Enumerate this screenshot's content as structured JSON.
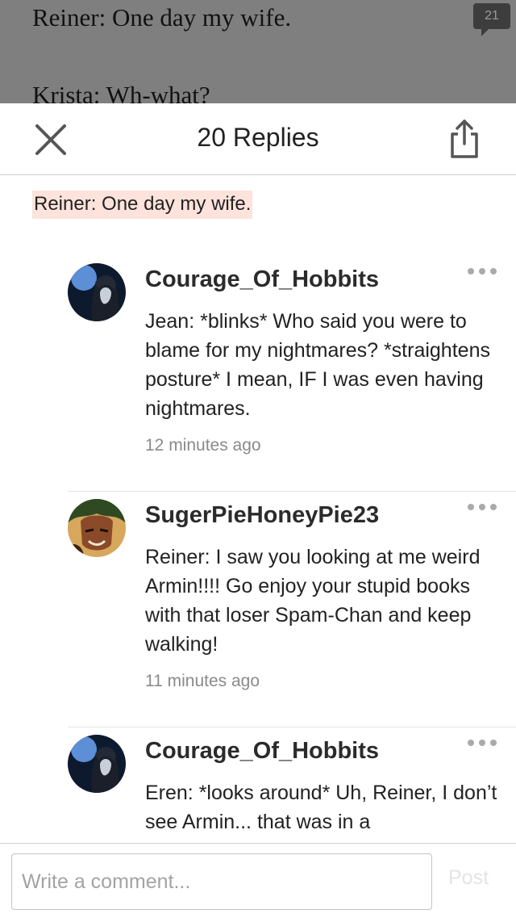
{
  "story": {
    "line1": "Reiner: One day my wife.",
    "line2": "Krista: Wh-what?",
    "comment_count": "21"
  },
  "sheet": {
    "title": "20 Replies",
    "quote": "Reiner: One day my wife."
  },
  "comments": [
    {
      "username": "Courage_Of_Hobbits",
      "body": "Jean: *blinks* Who said you were to blame for my nightmares? *straightens posture* I mean, IF I was even having nightmares.",
      "time": "12 minutes ago",
      "avatar_icon": "hooded-character-avatar"
    },
    {
      "username": "SugerPieHoneyPie23",
      "body": "Reiner: I saw you looking at me weird Armin!!!! Go enjoy your stupid books with that loser Spam-Chan and keep walking!",
      "time": "11 minutes ago",
      "avatar_icon": "green-haired-character-avatar"
    },
    {
      "username": "Courage_Of_Hobbits",
      "body": "Eren: *looks around* Uh, Reiner, I don’t see Armin... that was in a",
      "time": "",
      "avatar_icon": "hooded-character-avatar"
    }
  ],
  "footer": {
    "placeholder": "Write a comment...",
    "post_label": "Post"
  },
  "colors": {
    "quote_highlight": "#fde3db",
    "dim_overlay": "#7f7f7f"
  }
}
